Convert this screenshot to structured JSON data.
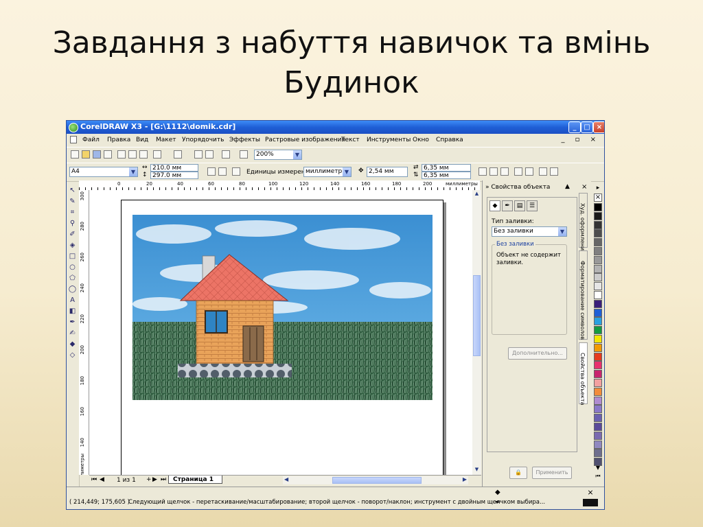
{
  "slide": {
    "title_line1": "Завдання з набуття навичок та вмінь",
    "title_line2": "Будинок"
  },
  "window": {
    "title": "CorelDRAW X3 - [G:\\1112\\domik.cdr]",
    "minimize": "_",
    "maximize": "□",
    "close": "×"
  },
  "menu": [
    "Файл",
    "Правка",
    "Вид",
    "Макет",
    "Упорядочить",
    "Эффекты",
    "Растровые изображения",
    "Текст",
    "Инструменты",
    "Окно",
    "Справка"
  ],
  "mdi_controls": "_ ▫ ×",
  "toolbar": {
    "zoom": "200%"
  },
  "property_bar": {
    "paper": "A4",
    "width": "210.0 мм",
    "height": "297.0 мм",
    "units_label": "Единицы измерения:",
    "units": "миллиметры",
    "nudge": "2,54 мм",
    "dup_x": "6,35 мм",
    "dup_y": "6,35 мм"
  },
  "rulers": {
    "h": [
      "0",
      "20",
      "40",
      "60",
      "80",
      "100",
      "120",
      "140",
      "160",
      "180",
      "200"
    ],
    "h_unit": "миллиметры",
    "v": [
      "300",
      "280",
      "260",
      "240",
      "220",
      "200",
      "180",
      "160",
      "140"
    ],
    "v_unit": "миллиметры"
  },
  "page_nav": {
    "counter": "1 из 1",
    "tab": "Страница 1"
  },
  "status": {
    "coords": "( 214,449; 175,605 )",
    "hint": "Следующий щелчок - перетаскивание/масштабирование; второй щелчок - поворот/наклон; инструмент с двойным щелчком выбира..."
  },
  "panel": {
    "title": "Свойства объекта",
    "fill_type_label": "Тип заливки:",
    "fill_type": "Без заливки",
    "group_title": "Без заливки",
    "group_text": "Объект не содержит заливки.",
    "more_button": "Дополнительно...",
    "apply_button": "Применить"
  },
  "side_tabs": [
    "Худ. оформление",
    "Форматирование символов",
    "Свойства объекта"
  ],
  "palette": [
    "#000000",
    "#1a1a1a",
    "#333333",
    "#4d4d4d",
    "#666666",
    "#808080",
    "#999999",
    "#b3b3b3",
    "#cccccc",
    "#e6e6e6",
    "#ffffff",
    "#3a1f7a",
    "#1f5fd6",
    "#2aa0e0",
    "#139a3f",
    "#f2e600",
    "#f29a00",
    "#e63a1e",
    "#e8306e",
    "#c8246e",
    "#f2a0a0",
    "#f28c3a",
    "#b08cd0",
    "#8a78c8",
    "#6a60b0",
    "#5a4a9a",
    "#7a6ab0",
    "#9088c0",
    "#6e6e8e",
    "#505070"
  ]
}
